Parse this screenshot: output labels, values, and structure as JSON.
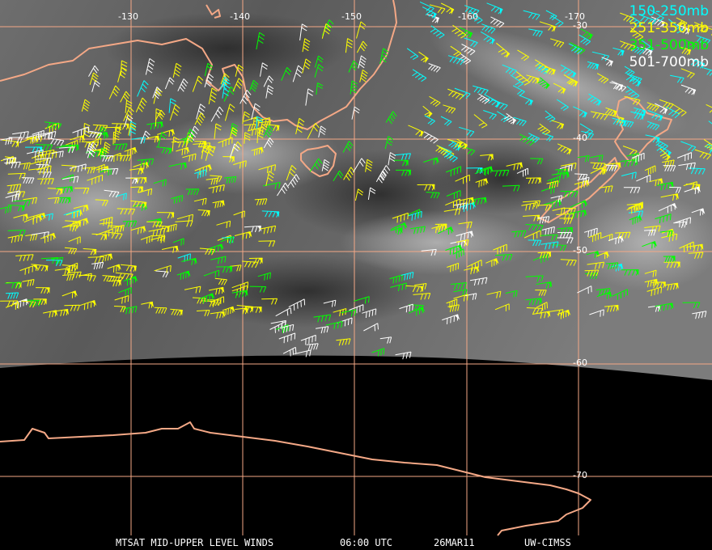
{
  "legend": {
    "items": [
      {
        "label": "150-250mb",
        "color": "#00ffff"
      },
      {
        "label": "251-350mb",
        "color": "#ffff00"
      },
      {
        "label": "351-500mb",
        "color": "#00ff00"
      },
      {
        "label": "501-700mb",
        "color": "#ffffff"
      }
    ]
  },
  "longitude_labels": [
    "-130",
    "-140",
    "-150",
    "-160",
    "-170"
  ],
  "latitude_labels": [
    "-30",
    "-40",
    "-50",
    "-60",
    "-70"
  ],
  "footer": {
    "product": "MTSAT MID-UPPER LEVEL WINDS",
    "time": "06:00 UTC",
    "date": "26MAR11",
    "credit": "UW-CIMSS"
  },
  "colors": {
    "coastline": "#f4a886",
    "grid": "#f4a886",
    "background_night": "#000000",
    "imagery_light": "#7a7a7a"
  }
}
